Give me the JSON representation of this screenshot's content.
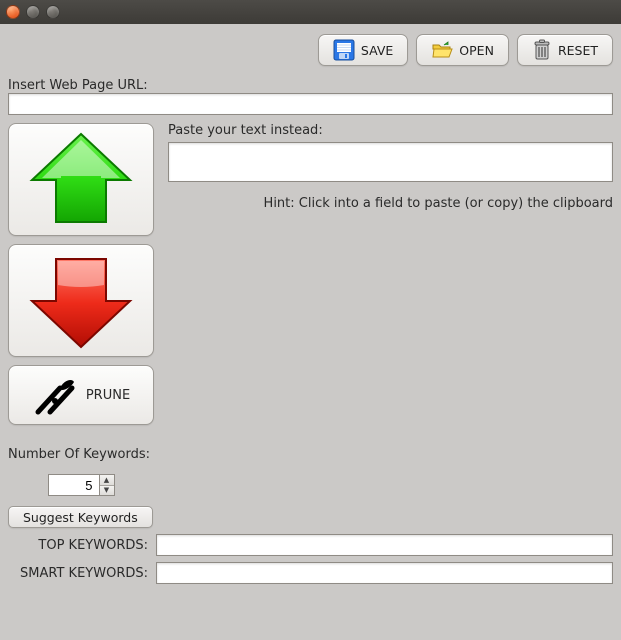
{
  "toolbar": {
    "save_label": "SAVE",
    "open_label": "OPEN",
    "reset_label": "RESET"
  },
  "url": {
    "label": "Insert Web Page URL:",
    "value": ""
  },
  "paste": {
    "label": "Paste your text instead:",
    "value": ""
  },
  "left": {
    "prune_label": "PRUNE",
    "num_kw_label": "Number Of Keywords:",
    "num_kw_value": "5"
  },
  "hint": "Hint: Click into a field to paste (or copy) the clipboard",
  "suggest_label": "Suggest Keywords",
  "top_kw": {
    "label": "TOP KEYWORDS:",
    "value": ""
  },
  "smart_kw": {
    "label": "SMART KEYWORDS:",
    "value": ""
  }
}
